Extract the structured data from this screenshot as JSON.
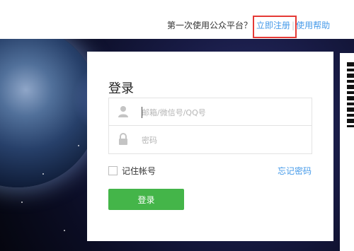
{
  "header": {
    "first_time_text": "第一次使用公众平台？",
    "register_link": "立即注册",
    "separator": "|",
    "help_link": "使用帮助"
  },
  "login": {
    "title": "登录",
    "account_placeholder": "邮箱/微信号/QQ号",
    "password_placeholder": "密码",
    "remember_label": "记住帐号",
    "forgot_link": "忘记密码",
    "submit_label": "登录"
  },
  "colors": {
    "link": "#459ae9",
    "button": "#44b549",
    "highlight": "#e53935"
  },
  "icons": {
    "account": "user-icon",
    "password": "lock-icon"
  }
}
